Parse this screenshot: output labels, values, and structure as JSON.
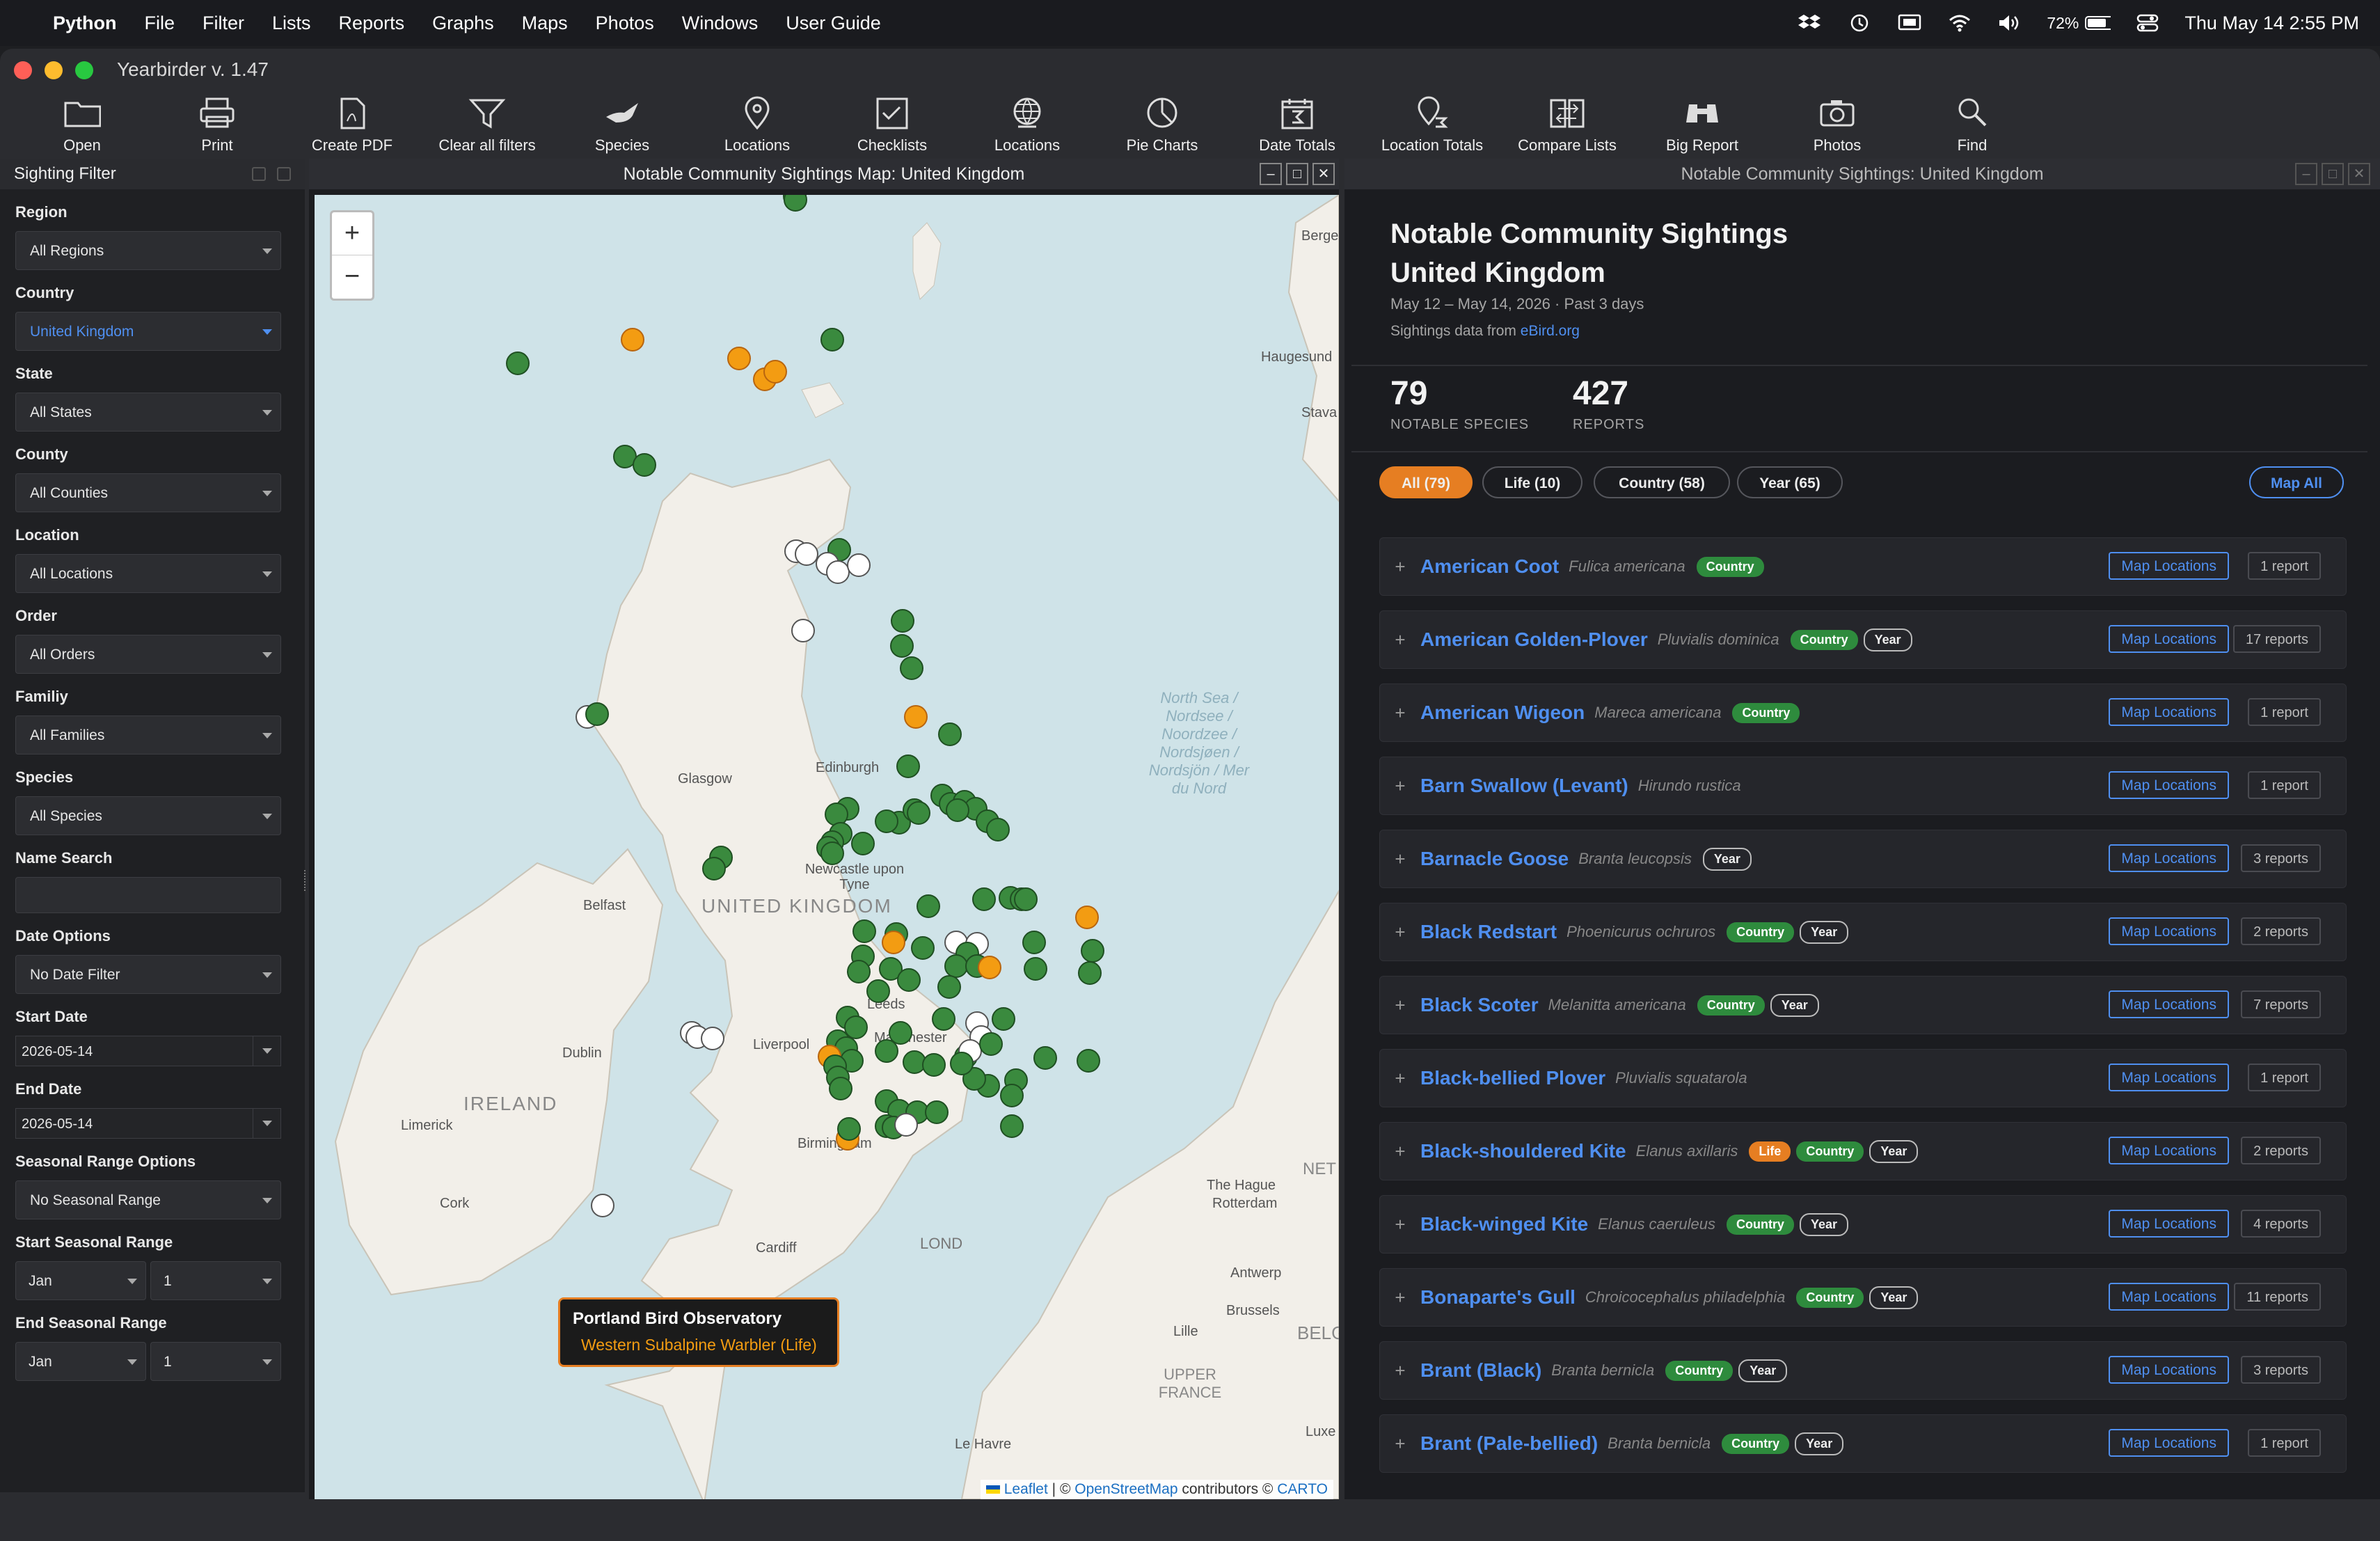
{
  "menubar": {
    "app": "Python",
    "items": [
      "File",
      "Filter",
      "Lists",
      "Reports",
      "Graphs",
      "Maps",
      "Photos",
      "Windows",
      "User Guide"
    ],
    "battery": "72%",
    "datetime": "Thu May 14  2:55 PM"
  },
  "window": {
    "title": "Yearbirder v. 1.47"
  },
  "toolbar": [
    {
      "label": "Open",
      "icon": "folder-icon"
    },
    {
      "label": "Print",
      "icon": "printer-icon"
    },
    {
      "label": "Create PDF",
      "icon": "pdf-icon"
    },
    {
      "label": "Clear all filters",
      "icon": "filter-icon"
    },
    {
      "label": "Species",
      "icon": "bird-icon"
    },
    {
      "label": "Locations",
      "icon": "pin-icon"
    },
    {
      "label": "Checklists",
      "icon": "checklist-icon"
    },
    {
      "label": "Locations",
      "icon": "globe-icon"
    },
    {
      "label": "Pie Charts",
      "icon": "pie-chart-icon"
    },
    {
      "label": "Date Totals",
      "icon": "calendar-sum-icon"
    },
    {
      "label": "Location Totals",
      "icon": "pin-sum-icon"
    },
    {
      "label": "Compare Lists",
      "icon": "compare-icon"
    },
    {
      "label": "Big Report",
      "icon": "binoculars-icon"
    },
    {
      "label": "Photos",
      "icon": "camera-icon"
    },
    {
      "label": "Find",
      "icon": "search-icon"
    }
  ],
  "sidebar": {
    "title": "Sighting Filter",
    "region": {
      "label": "Region",
      "value": "All Regions"
    },
    "country": {
      "label": "Country",
      "value": "United Kingdom"
    },
    "state": {
      "label": "State",
      "value": "All States"
    },
    "county": {
      "label": "County",
      "value": "All Counties"
    },
    "location": {
      "label": "Location",
      "value": "All Locations"
    },
    "order": {
      "label": "Order",
      "value": "All Orders"
    },
    "family": {
      "label": "Familiy",
      "value": "All Families"
    },
    "species": {
      "label": "Species",
      "value": "All Species"
    },
    "name_search": {
      "label": "Name Search",
      "value": ""
    },
    "date_options": {
      "label": "Date Options",
      "value": "No Date Filter"
    },
    "start_date": {
      "label": "Start Date",
      "value": "2026-05-14"
    },
    "end_date": {
      "label": "End Date",
      "value": "2026-05-14"
    },
    "seasonal": {
      "label": "Seasonal Range Options",
      "value": "No Seasonal Range"
    },
    "start_seasonal": {
      "label": "Start Seasonal Range",
      "month": "Jan",
      "day": "1"
    },
    "end_seasonal": {
      "label": "End Seasonal Range",
      "month": "Jan",
      "day": "1"
    }
  },
  "map": {
    "title": "Notable Community Sightings Map: United Kingdom",
    "zoom_in": "+",
    "zoom_out": "−",
    "labels": {
      "bergen": "Bergen",
      "haugesund": "Haugesund",
      "stava": "Stava",
      "glasgow": "Glasgow",
      "edinburgh": "Edinburgh",
      "newcastle": "Newcastle upon Tyne",
      "uk": "UNITED KINGDOM",
      "belfast": "Belfast",
      "leeds": "Leeds",
      "liverpool": "Liverpool",
      "manchester": "Manchester",
      "dublin": "Dublin",
      "ireland": "IRELAND",
      "limerick": "Limerick",
      "cork": "Cork",
      "birmingham": "Birmingham",
      "cardiff": "Cardiff",
      "london": "LOND",
      "north_sea": "North Sea / Nordsee / Noordzee / Nordsjøen / Nordsjön / Mer du Nord",
      "the_hague": "The Hague",
      "rotterdam": "Rotterdam",
      "antwerp": "Antwerp",
      "brussels": "Brussels",
      "lille": "Lille",
      "belgium": "BELGIU",
      "upper_france": "UPPER FRANCE",
      "le_havre": "Le Havre",
      "lux": "Luxe",
      "net": "NET"
    },
    "attribution": {
      "leaflet": "Leaflet",
      "mid": "| ©",
      "osm": "OpenStreetMap",
      "contrib": "contributors ©",
      "carto": "CARTO"
    },
    "tooltip": {
      "title": "Portland Bird Observatory",
      "subtitle": "Western Subalpine Warbler (Life)"
    }
  },
  "right": {
    "header": "Notable Community Sightings: United Kingdom",
    "title1": "Notable Community Sightings",
    "title2": "United Kingdom",
    "dates": "May 12 – May 14, 2026  ·  Past 3 days",
    "source_prefix": "Sightings data from",
    "source_link": "eBird.org",
    "stats": [
      {
        "num": "79",
        "label": "NOTABLE SPECIES"
      },
      {
        "num": "427",
        "label": "REPORTS"
      }
    ],
    "filters": [
      "All (79)",
      "Life (10)",
      "Country (58)",
      "Year (65)"
    ],
    "map_all": "Map All",
    "map_btn": "Map Locations",
    "species": [
      {
        "name": "American Coot",
        "sci": "Fulica americana",
        "badges": [
          "Country"
        ],
        "reports": "1 report"
      },
      {
        "name": "American Golden-Plover",
        "sci": "Pluvialis dominica",
        "badges": [
          "Country",
          "Year"
        ],
        "reports": "17 reports"
      },
      {
        "name": "American Wigeon",
        "sci": "Mareca americana",
        "badges": [
          "Country"
        ],
        "reports": "1 report"
      },
      {
        "name": "Barn Swallow (Levant)",
        "sci": "Hirundo rustica",
        "badges": [],
        "reports": "1 report"
      },
      {
        "name": "Barnacle Goose",
        "sci": "Branta leucopsis",
        "badges": [
          "Year"
        ],
        "reports": "3 reports"
      },
      {
        "name": "Black Redstart",
        "sci": "Phoenicurus ochruros",
        "badges": [
          "Country",
          "Year"
        ],
        "reports": "2 reports"
      },
      {
        "name": "Black Scoter",
        "sci": "Melanitta americana",
        "badges": [
          "Country",
          "Year"
        ],
        "reports": "7 reports"
      },
      {
        "name": "Black-bellied Plover",
        "sci": "Pluvialis squatarola",
        "badges": [],
        "reports": "1 report"
      },
      {
        "name": "Black-shouldered Kite",
        "sci": "Elanus axillaris",
        "badges": [
          "Life",
          "Country",
          "Year"
        ],
        "reports": "2 reports"
      },
      {
        "name": "Black-winged Kite",
        "sci": "Elanus caeruleus",
        "badges": [
          "Country",
          "Year"
        ],
        "reports": "4 reports"
      },
      {
        "name": "Bonaparte's Gull",
        "sci": "Chroicocephalus philadelphia",
        "badges": [
          "Country",
          "Year"
        ],
        "reports": "11 reports"
      },
      {
        "name": "Brant (Black)",
        "sci": "Branta bernicla",
        "badges": [
          "Country",
          "Year"
        ],
        "reports": "3 reports"
      },
      {
        "name": "Brant (Pale-bellied)",
        "sci": "Branta bernicla",
        "badges": [
          "Country",
          "Year"
        ],
        "reports": "1 report"
      }
    ]
  },
  "colors": {
    "accent": "#4f8ff0",
    "orange": "#e67e22",
    "green": "#2e8b3d",
    "marker_green": "#3a8a3e",
    "marker_orange": "#f39c12"
  }
}
